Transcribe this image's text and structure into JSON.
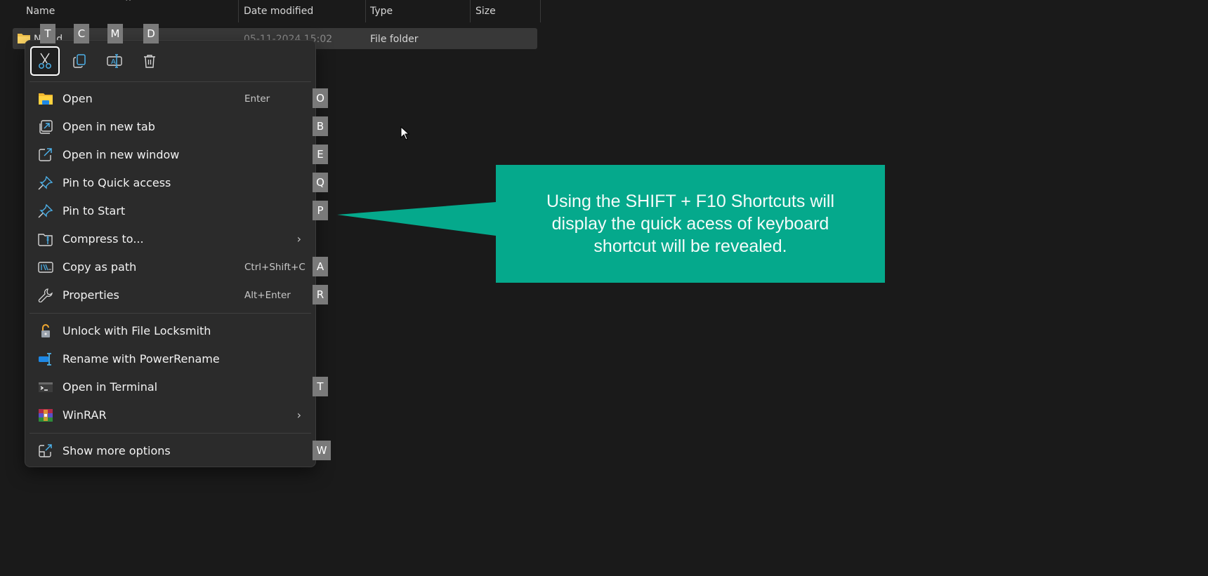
{
  "explorer": {
    "columns": [
      {
        "label": "Name"
      },
      {
        "label": "Date modified"
      },
      {
        "label": "Type"
      },
      {
        "label": "Size"
      }
    ],
    "sort_indicator": "^",
    "rows": [
      {
        "name": "New folder",
        "name_visible": "N   fold",
        "date_modified": "05-11-2024 15:02",
        "type": "File folder",
        "size": ""
      }
    ]
  },
  "context_menu": {
    "quick_actions": [
      {
        "name": "cut",
        "icon": "scissors-icon",
        "keytip": "T",
        "focused": true
      },
      {
        "name": "copy",
        "icon": "copy-icon",
        "keytip": "C",
        "focused": false
      },
      {
        "name": "rename",
        "icon": "rename-icon",
        "keytip": "M",
        "focused": false
      },
      {
        "name": "delete",
        "icon": "trash-icon",
        "keytip": "D",
        "focused": false
      }
    ],
    "items": [
      {
        "label": "Open",
        "shortcut": "Enter",
        "keytip": "O",
        "icon": "folder-icon",
        "submenu": false
      },
      {
        "label": "Open in new tab",
        "shortcut": "",
        "keytip": "B",
        "icon": "new-tab-icon",
        "submenu": false
      },
      {
        "label": "Open in new window",
        "shortcut": "",
        "keytip": "E",
        "icon": "new-window-icon",
        "submenu": false
      },
      {
        "label": "Pin to Quick access",
        "shortcut": "",
        "keytip": "Q",
        "icon": "pin-icon",
        "submenu": false
      },
      {
        "label": "Pin to Start",
        "shortcut": "",
        "keytip": "P",
        "icon": "pin-icon",
        "submenu": false
      },
      {
        "label": "Compress to...",
        "shortcut": "",
        "keytip": "",
        "icon": "zip-folder-icon",
        "submenu": true
      },
      {
        "label": "Copy as path",
        "shortcut": "Ctrl+Shift+C",
        "keytip": "A",
        "icon": "copy-path-icon",
        "submenu": false
      },
      {
        "label": "Properties",
        "shortcut": "Alt+Enter",
        "keytip": "R",
        "icon": "wrench-icon",
        "submenu": false
      },
      {
        "label": "Unlock with File Locksmith",
        "shortcut": "",
        "keytip": "",
        "icon": "unlock-icon",
        "submenu": false
      },
      {
        "label": "Rename with PowerRename",
        "shortcut": "",
        "keytip": "",
        "icon": "powerrename-icon",
        "submenu": false
      },
      {
        "label": "Open in Terminal",
        "shortcut": "",
        "keytip": "T",
        "icon": "terminal-icon",
        "submenu": false
      },
      {
        "label": "WinRAR",
        "shortcut": "",
        "keytip": "",
        "icon": "winrar-icon",
        "submenu": true
      },
      {
        "label": "Show more options",
        "shortcut": "",
        "keytip": "W",
        "icon": "show-more-icon",
        "submenu": false
      }
    ],
    "submenu_chevron": "›"
  },
  "callout": {
    "text": "Using the SHIFT + F10 Shortcuts will display the quick acess of keyboard shortcut will be revealed.",
    "color": "#05a98c"
  },
  "colors": {
    "background": "#1a1a1a",
    "menu": "#2b2b2b",
    "keytip": "#7a7a7a",
    "accent_icon": "#4cb0e8"
  }
}
